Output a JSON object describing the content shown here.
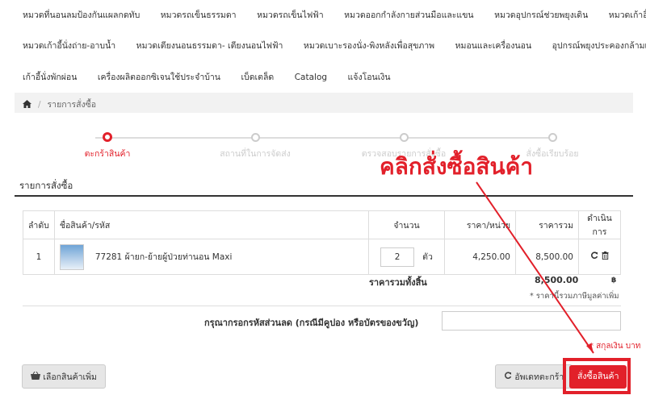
{
  "nav": {
    "row1": [
      "หมวดที่นอนลมป้องกันแผลกดทับ",
      "หมวดรถเข็นธรรมดา",
      "หมวดรถเข็นไฟฟ้า",
      "หมวดออกกำลังกายส่วนมือและแขน",
      "หมวดอุปกรณ์ช่วยพยุงเดิน",
      "หมวดเก้าอี้นั่งถ่าย"
    ],
    "row2": [
      "หมวดเก้าอี้นั่งถ่าย-อาบน้ำ",
      "หมวดเตียงนอนธรรมดา- เตียงนอนไฟฟ้า",
      "หมวดเบาะรองนั่ง-พิงหลังเพื่อสุขภาพ",
      "หมอนและเครื่องนอน",
      "อุปกรณ์พยุงประคองกล้ามเนื้อ"
    ],
    "row3": [
      "เก้าอี้นั่งพักผ่อน",
      "เครื่องผลิตออกซิเจนใช้ประจำบ้าน",
      "เบ็ดเตล็ด",
      "Catalog",
      "แจ้งโอนเงิน"
    ]
  },
  "breadcrumb": {
    "current": "รายการสั่งซื้อ"
  },
  "steps": [
    "ตะกร้าสินค้า",
    "สถานที่ในการจัดส่ง",
    "ตรวจสอบรายการสั่งซื้อ",
    "สั่งซื้อเรียบร้อย"
  ],
  "callout": "คลิกสั่งซื้อสินค้า",
  "section_title": "รายการสั่งซื้อ",
  "table": {
    "headers": [
      "ลำดับ",
      "ชื่อสินค้า/รหัส",
      "จำนวน",
      "ราคา/หน่วย",
      "ราคารวม",
      "ดำเนินการ"
    ],
    "rows": [
      {
        "no": "1",
        "name": "77281 ผ้ายก-ย้ายผู้ป่วยท่านอน Maxi",
        "qty": "2",
        "unit": "ตัว",
        "unit_price": "4,250.00",
        "total": "8,500.00"
      }
    ]
  },
  "summary": {
    "label": "ราคารวมทั้งสิ้น",
    "value": "8,500.00",
    "currency": "฿",
    "vat_note": "* ราคานี้รวมภาษีมูลค่าเพิ่ม"
  },
  "promo": {
    "label": "กรุณากรอกรหัสส่วนลด (กรณีมีคูปอง หรือบัตรของขวัญ)",
    "value": ""
  },
  "unit_note": "* สกุลเงิน บาท",
  "buttons": {
    "more": "เลือกสินค้าเพิ่ม",
    "update": "อัพเดทตะกร้า",
    "order": "สั่งซื้อสินค้า"
  },
  "colors": {
    "accent": "#e2202a"
  }
}
